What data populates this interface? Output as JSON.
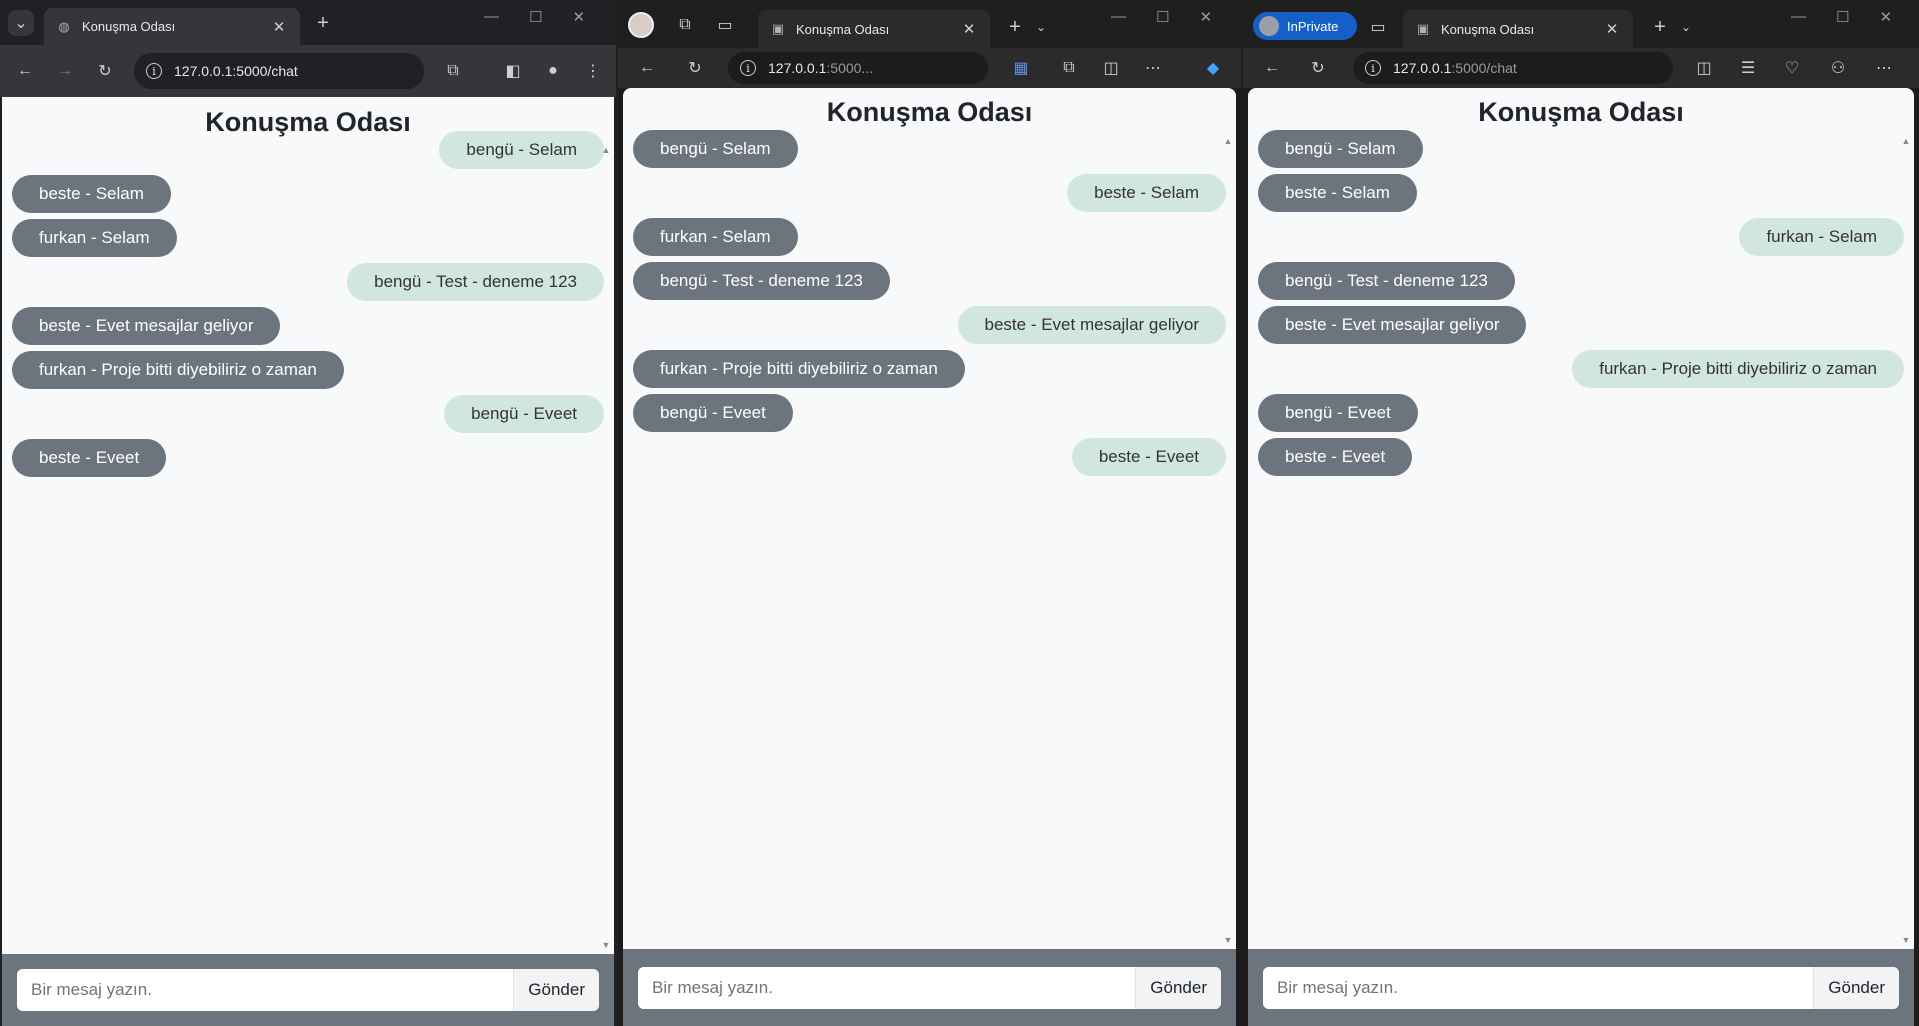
{
  "windows": [
    {
      "tab_title": "Konuşma Odası",
      "url_host": "127.0.0.1",
      "url_rest": ":5000/chat",
      "room_title": "Konuşma Odası",
      "messages": [
        {
          "text": "bengü - Selam",
          "self": true
        },
        {
          "text": "beste - Selam",
          "self": false
        },
        {
          "text": "furkan - Selam",
          "self": false
        },
        {
          "text": "bengü - Test - deneme 123",
          "self": true
        },
        {
          "text": "beste - Evet mesajlar geliyor",
          "self": false
        },
        {
          "text": "furkan - Proje bitti diyebiliriz o zaman",
          "self": false
        },
        {
          "text": "bengü - Eveet",
          "self": true
        },
        {
          "text": "beste - Eveet",
          "self": false
        }
      ],
      "input_placeholder": "Bir mesaj yazın.",
      "send_label": "Gönder"
    },
    {
      "tab_title": "Konuşma Odası",
      "url_host": "127.0.0.1",
      "url_rest": ":5000...",
      "room_title": "Konuşma Odası",
      "messages": [
        {
          "text": "bengü - Selam",
          "self": false
        },
        {
          "text": "beste - Selam",
          "self": true
        },
        {
          "text": "furkan - Selam",
          "self": false
        },
        {
          "text": "bengü - Test - deneme 123",
          "self": false
        },
        {
          "text": "beste - Evet mesajlar geliyor",
          "self": true
        },
        {
          "text": "furkan - Proje bitti diyebiliriz o zaman",
          "self": false
        },
        {
          "text": "bengü - Eveet",
          "self": false
        },
        {
          "text": "beste - Eveet",
          "self": true
        }
      ],
      "input_placeholder": "Bir mesaj yazın.",
      "send_label": "Gönder"
    },
    {
      "tab_title": "Konuşma Odası",
      "inprivate_label": "InPrivate",
      "url_host": "127.0.0.1",
      "url_rest": ":5000/chat",
      "room_title": "Konuşma Odası",
      "messages": [
        {
          "text": "bengü - Selam",
          "self": false
        },
        {
          "text": "beste - Selam",
          "self": false
        },
        {
          "text": "furkan - Selam",
          "self": true
        },
        {
          "text": "bengü - Test - deneme 123",
          "self": false
        },
        {
          "text": "beste - Evet mesajlar geliyor",
          "self": false
        },
        {
          "text": "furkan - Proje bitti diyebiliriz o zaman",
          "self": true
        },
        {
          "text": "bengü - Eveet",
          "self": false
        },
        {
          "text": "beste - Eveet",
          "self": false
        }
      ],
      "input_placeholder": "Bir mesaj yazın.",
      "send_label": "Gönder"
    }
  ],
  "colors": {
    "other_bubble": "#6c757d",
    "self_bubble": "#d1e7dd",
    "input_bar": "#6c757d",
    "inprivate_badge": "#1460c8"
  }
}
